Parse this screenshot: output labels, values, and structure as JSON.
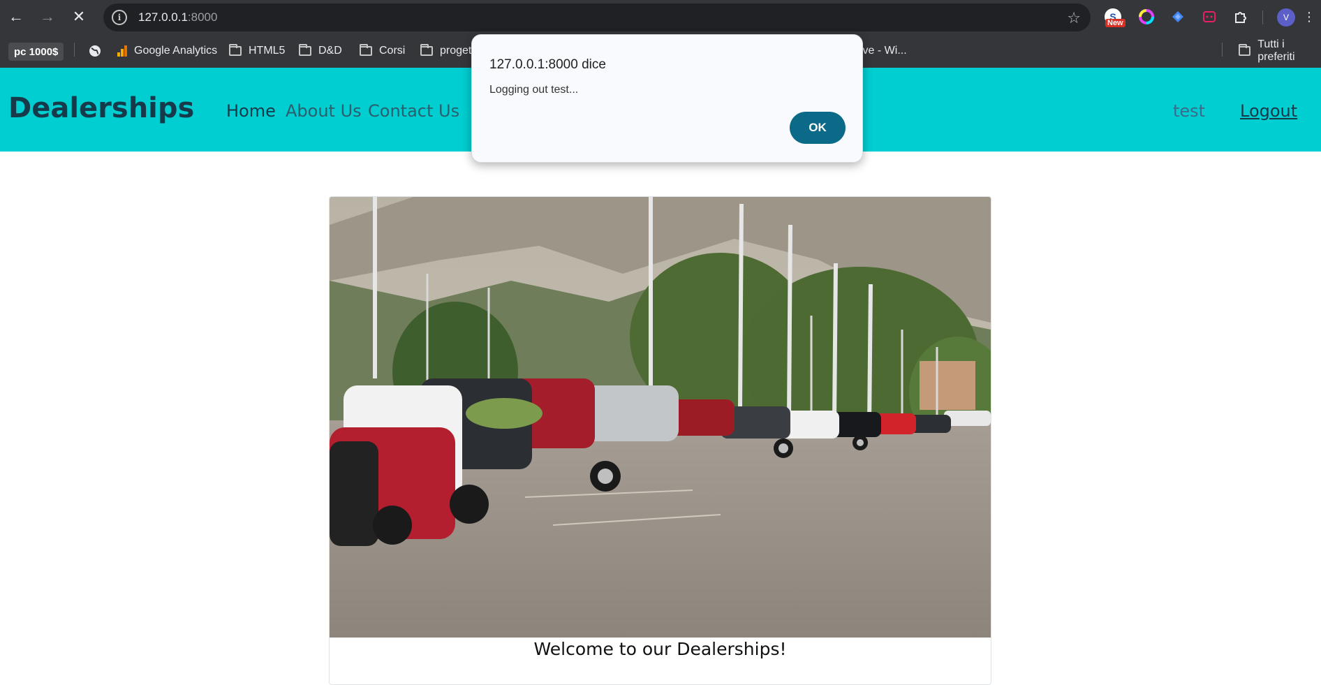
{
  "browser": {
    "url_host": "127.0.0.1",
    "url_port": ":8000",
    "new_badge": "New",
    "avatar_letter": "V",
    "bookmarks": [
      {
        "label": "pc 1000$"
      },
      {
        "label": "Google Analytics"
      },
      {
        "label": "HTML5"
      },
      {
        "label": "D&D"
      },
      {
        "label": "Corsi"
      },
      {
        "label": "proget"
      },
      {
        "label": "ive - Wi..."
      },
      {
        "label": "Tutti i preferiti"
      }
    ]
  },
  "site": {
    "brand": "Dealerships",
    "nav": [
      "Home",
      "About Us",
      "Contact Us"
    ],
    "user": "test",
    "logout": "Logout",
    "welcome": "Welcome to our Dealerships!",
    "navbar_color": "#00ced1"
  },
  "dialog": {
    "title": "127.0.0.1:8000 dice",
    "message": "Logging out test...",
    "ok": "OK"
  }
}
